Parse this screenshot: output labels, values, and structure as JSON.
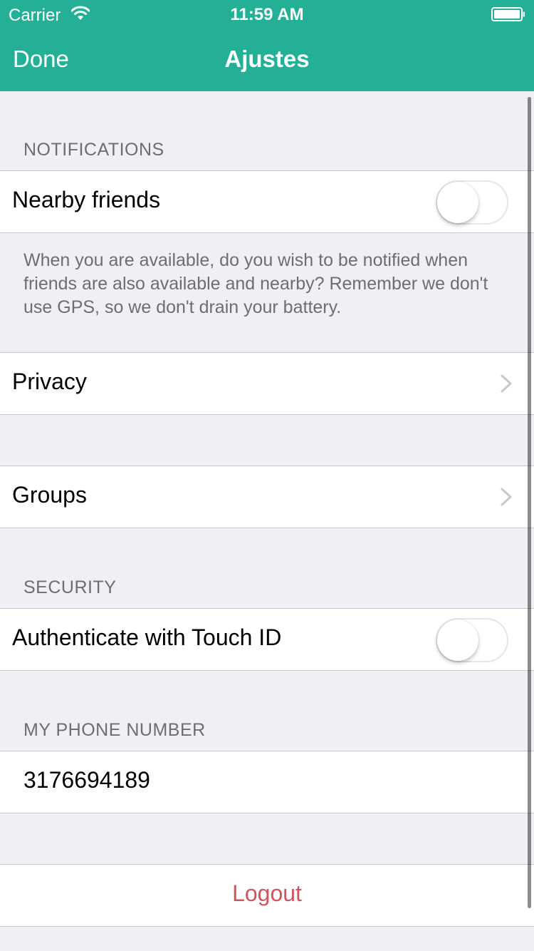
{
  "status_bar": {
    "carrier": "Carrier",
    "time": "11:59 AM",
    "icons": [
      "wifi-icon",
      "battery-icon"
    ]
  },
  "nav": {
    "done_label": "Done",
    "title": "Ajustes"
  },
  "colors": {
    "accent": "#24b096",
    "background": "#efeff4",
    "logout": "#d0545e"
  },
  "notifications": {
    "header": "NOTIFICATIONS",
    "nearby_friends_label": "Nearby friends",
    "nearby_friends_enabled": false,
    "footer": "When you are available, do you wish to be notified when friends are also available and nearby? Remember we don't use GPS, so we don't drain your battery."
  },
  "privacy": {
    "label": "Privacy"
  },
  "groups": {
    "label": "Groups"
  },
  "security": {
    "header": "SECURITY",
    "touch_id_label": "Authenticate with Touch ID",
    "touch_id_enabled": false
  },
  "phone": {
    "header": "MY PHONE NUMBER",
    "value": "3176694189"
  },
  "logout": {
    "label": "Logout"
  }
}
